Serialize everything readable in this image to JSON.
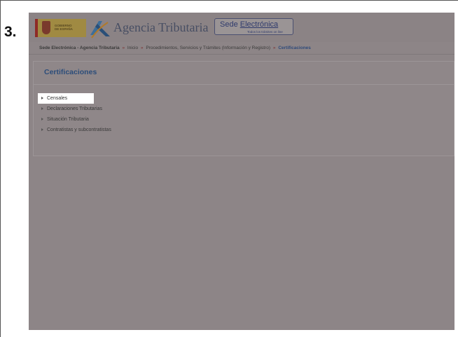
{
  "step_label": "3.",
  "header": {
    "gov_logo_text": "GOBIERNO\nDE ESPAÑA",
    "agency_name": "Agencia Tributaria",
    "sede_prefix": "Sede ",
    "sede_highlight": "Electrónica",
    "sede_subtitle": "Todos los trámites on line"
  },
  "breadcrumb": {
    "items": [
      "Sede Electrónica - Agencia Tributaria",
      "Inicio",
      "Procedimientos, Servicios y Trámites (Información y Registro)",
      "Certificaciones"
    ],
    "separator": "»"
  },
  "panel": {
    "title": "Certificaciones",
    "items": [
      {
        "label": "Censales",
        "selected": true
      },
      {
        "label": "Declaraciones Tributarias",
        "selected": false
      },
      {
        "label": "Situación Tributaria",
        "selected": false
      },
      {
        "label": "Contratistas y subcontratistas",
        "selected": false
      }
    ]
  },
  "colors": {
    "overlay_gray": "#8d8587",
    "title_blue": "#2c4d7a",
    "breadcrumb_current": "#2f4a7a",
    "selected_bg": "#ffffff"
  }
}
